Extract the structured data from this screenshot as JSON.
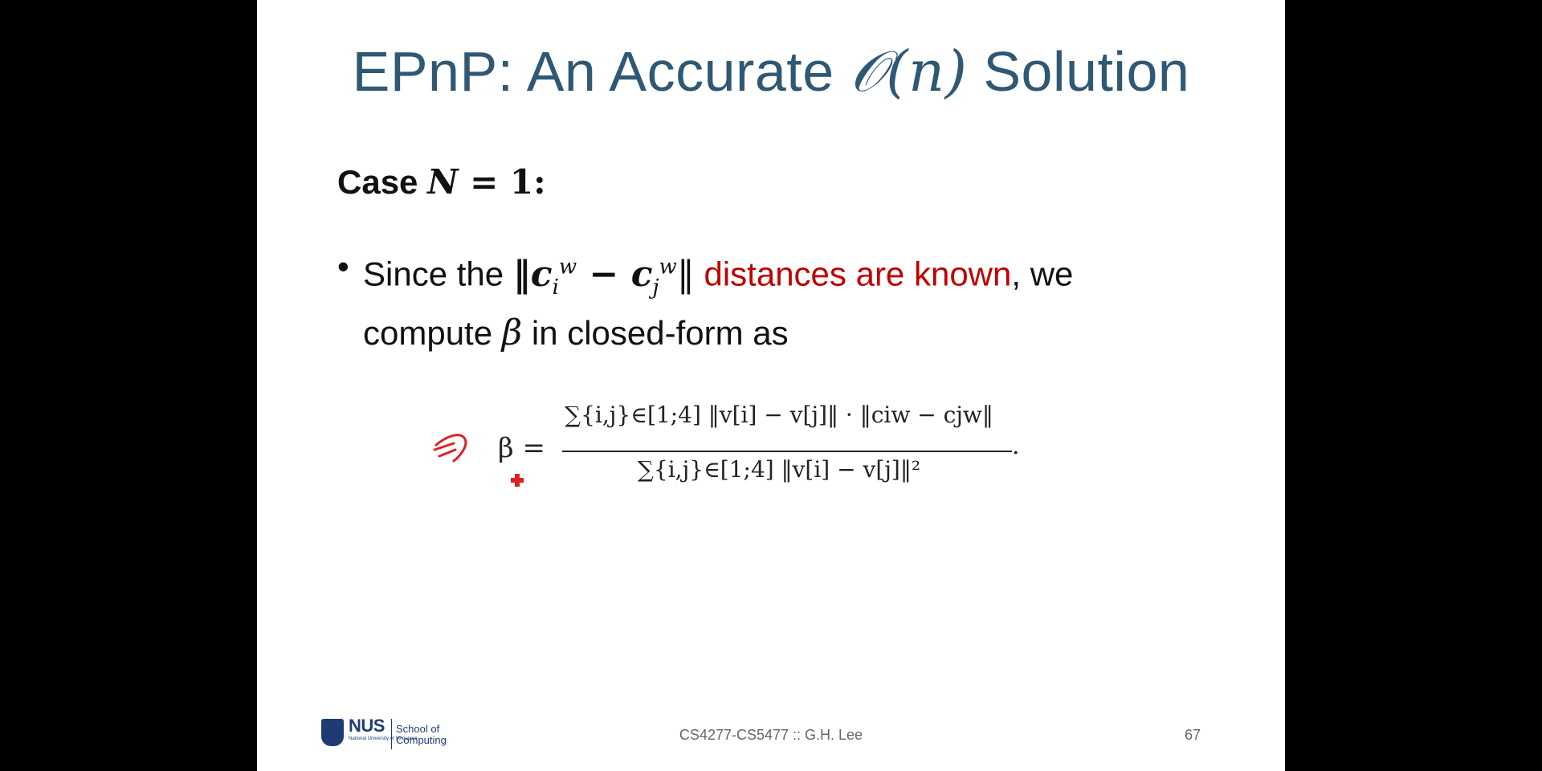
{
  "slide": {
    "title_prefix": "EPnP: An Accurate ",
    "title_math": "𝒪(𝑛)",
    "title_suffix": " Solution",
    "case_label": "Case ",
    "case_math_var": "N",
    "case_math_rest": " = 1:",
    "bullet": {
      "text_before": "Since the ",
      "norm_expr": "‖c",
      "sub_i": "i",
      "sup_w1": "w",
      "minus": " − c",
      "sub_j": "j",
      "sup_w2": "w",
      "norm_close": "‖",
      "highlight": "distances are known",
      "text_after": ", we compute ",
      "beta": "β",
      "text_end": " in closed-form as"
    },
    "formula": {
      "lhs": "β =",
      "numerator": "∑{i,j}∈[1;4] ‖v[i] − v[j]‖ · ‖ciw − cjw‖",
      "denominator": "∑{i,j}∈[1;4] ‖v[i] − v[j]‖²",
      "period": "."
    },
    "footer": {
      "logo_text": "NUS",
      "logo_subtext": "National University of Singapore",
      "school": "School of Computing",
      "course": "CS4277-CS5477 :: G.H. Lee",
      "page_number": "67"
    },
    "colors": {
      "title": "#2f5874",
      "highlight": "#c00000",
      "annotation": "#e02020",
      "background": "#000000"
    },
    "icons": {
      "annotation": "red-hand-drawn-arrow-icon",
      "cursor": "red-cross-cursor-icon"
    }
  }
}
